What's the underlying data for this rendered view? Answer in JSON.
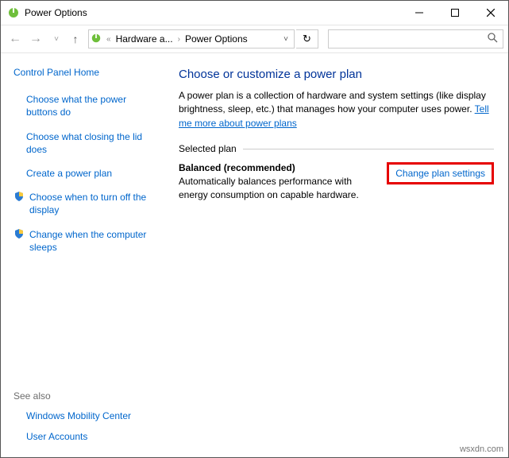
{
  "titlebar": {
    "title": "Power Options"
  },
  "breadcrumb": {
    "level1": "Hardware a...",
    "level2": "Power Options"
  },
  "sidebar": {
    "home": "Control Panel Home",
    "items": [
      {
        "label": "Choose what the power buttons do"
      },
      {
        "label": "Choose what closing the lid does"
      },
      {
        "label": "Create a power plan"
      },
      {
        "label": "Choose when to turn off the display"
      },
      {
        "label": "Change when the computer sleeps"
      }
    ],
    "seealso_heading": "See also",
    "seealso": [
      {
        "label": "Windows Mobility Center"
      },
      {
        "label": "User Accounts"
      }
    ]
  },
  "main": {
    "heading": "Choose or customize a power plan",
    "description_pre": "A power plan is a collection of hardware and system settings (like display brightness, sleep, etc.) that manages how your computer uses power. ",
    "description_link": "Tell me more about power plans",
    "selected_heading": "Selected plan",
    "plan_name": "Balanced (recommended)",
    "plan_desc": "Automatically balances performance with energy consumption on capable hardware.",
    "change_link": "Change plan settings"
  },
  "watermark": "wsxdn.com"
}
